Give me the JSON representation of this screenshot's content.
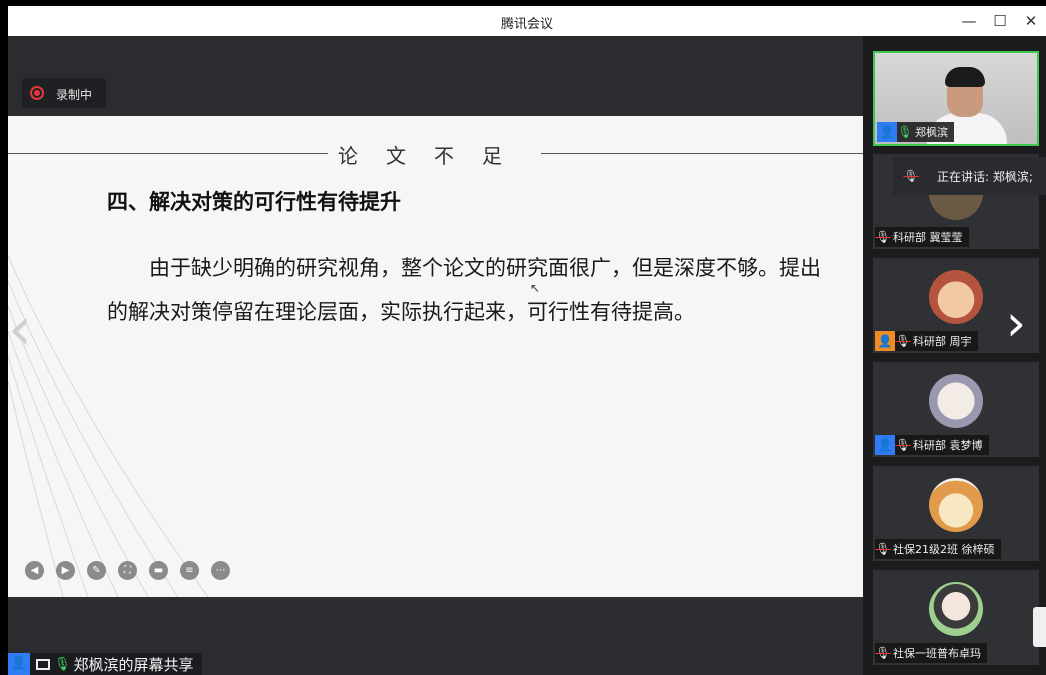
{
  "window": {
    "title": "腾讯会议"
  },
  "recording": {
    "label": "录制中"
  },
  "slide": {
    "header": "论文不足",
    "heading": "四、解决对策的可行性有待提升",
    "body": "由于缺少明确的研究视角，整个论文的研究面很广，但是深度不够。提出的解决对策停留在理论层面，实际执行起来，可行性有待提高。"
  },
  "ppt_tools": [
    "prev-icon",
    "next-icon",
    "pen-icon",
    "screenshot-icon",
    "camera-icon",
    "comment-icon",
    "more-icon"
  ],
  "share": {
    "label": "郑枫滨的屏幕共享"
  },
  "speaking": {
    "text": "正在讲话: 郑枫滨;"
  },
  "participants": [
    {
      "name": "郑枫滨",
      "type": "camera",
      "mic": "on",
      "host_icon": true,
      "host_color": "#2f7cf6"
    },
    {
      "name": "科研部 冀莹莹",
      "type": "avatar",
      "mic": "muted",
      "host_icon": false
    },
    {
      "name": "科研部 周宇",
      "type": "avatar",
      "mic": "muted",
      "host_icon": true,
      "host_color": "#f08a24"
    },
    {
      "name": "科研部 袁梦博",
      "type": "avatar",
      "mic": "muted",
      "host_icon": true,
      "host_color": "#2f7cf6"
    },
    {
      "name": "社保21级2班  徐梓硕",
      "type": "avatar",
      "mic": "muted",
      "host_icon": false
    },
    {
      "name": "社保一班普布卓玛",
      "type": "avatar",
      "mic": "muted",
      "host_icon": false
    }
  ],
  "colors": {
    "accent_green": "#3ec84f",
    "record_red": "#e03a3a",
    "host_blue": "#2f7cf6"
  }
}
